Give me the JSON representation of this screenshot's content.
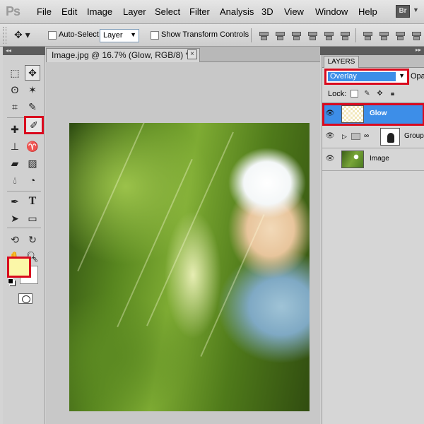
{
  "app": {
    "logo": "Ps"
  },
  "menu": [
    "File",
    "Edit",
    "Image",
    "Layer",
    "Select",
    "Filter",
    "Analysis",
    "3D",
    "View",
    "Window",
    "Help"
  ],
  "bridge_button": "Br",
  "options_bar": {
    "auto_select_label": "Auto-Select:",
    "auto_select_value": "Layer",
    "auto_select_checked": false,
    "transform_controls_label": "Show Transform Controls",
    "transform_controls_checked": false
  },
  "document": {
    "tab_title": "Image.jpg @ 16.7% (Glow, RGB/8) *",
    "close_glyph": "×"
  },
  "toolbox": {
    "collapse_glyph": "◂◂",
    "foreground_color": "#fbf7a8",
    "background_color": "#ffffff",
    "highlighted_tool": "brush-tool"
  },
  "layers_panel": {
    "tab_label": "LAYERS",
    "blend_mode": "Overlay",
    "opacity_label": "Opac",
    "lock_label": "Lock:",
    "layers": [
      {
        "name": "Glow",
        "selected": true,
        "visible": true
      },
      {
        "name": "Group",
        "selected": false,
        "visible": true,
        "type": "group"
      },
      {
        "name": "Image",
        "selected": false,
        "visible": true
      }
    ]
  },
  "colors": {
    "highlight": "#d90a1e",
    "selection": "#3d8ee8"
  }
}
